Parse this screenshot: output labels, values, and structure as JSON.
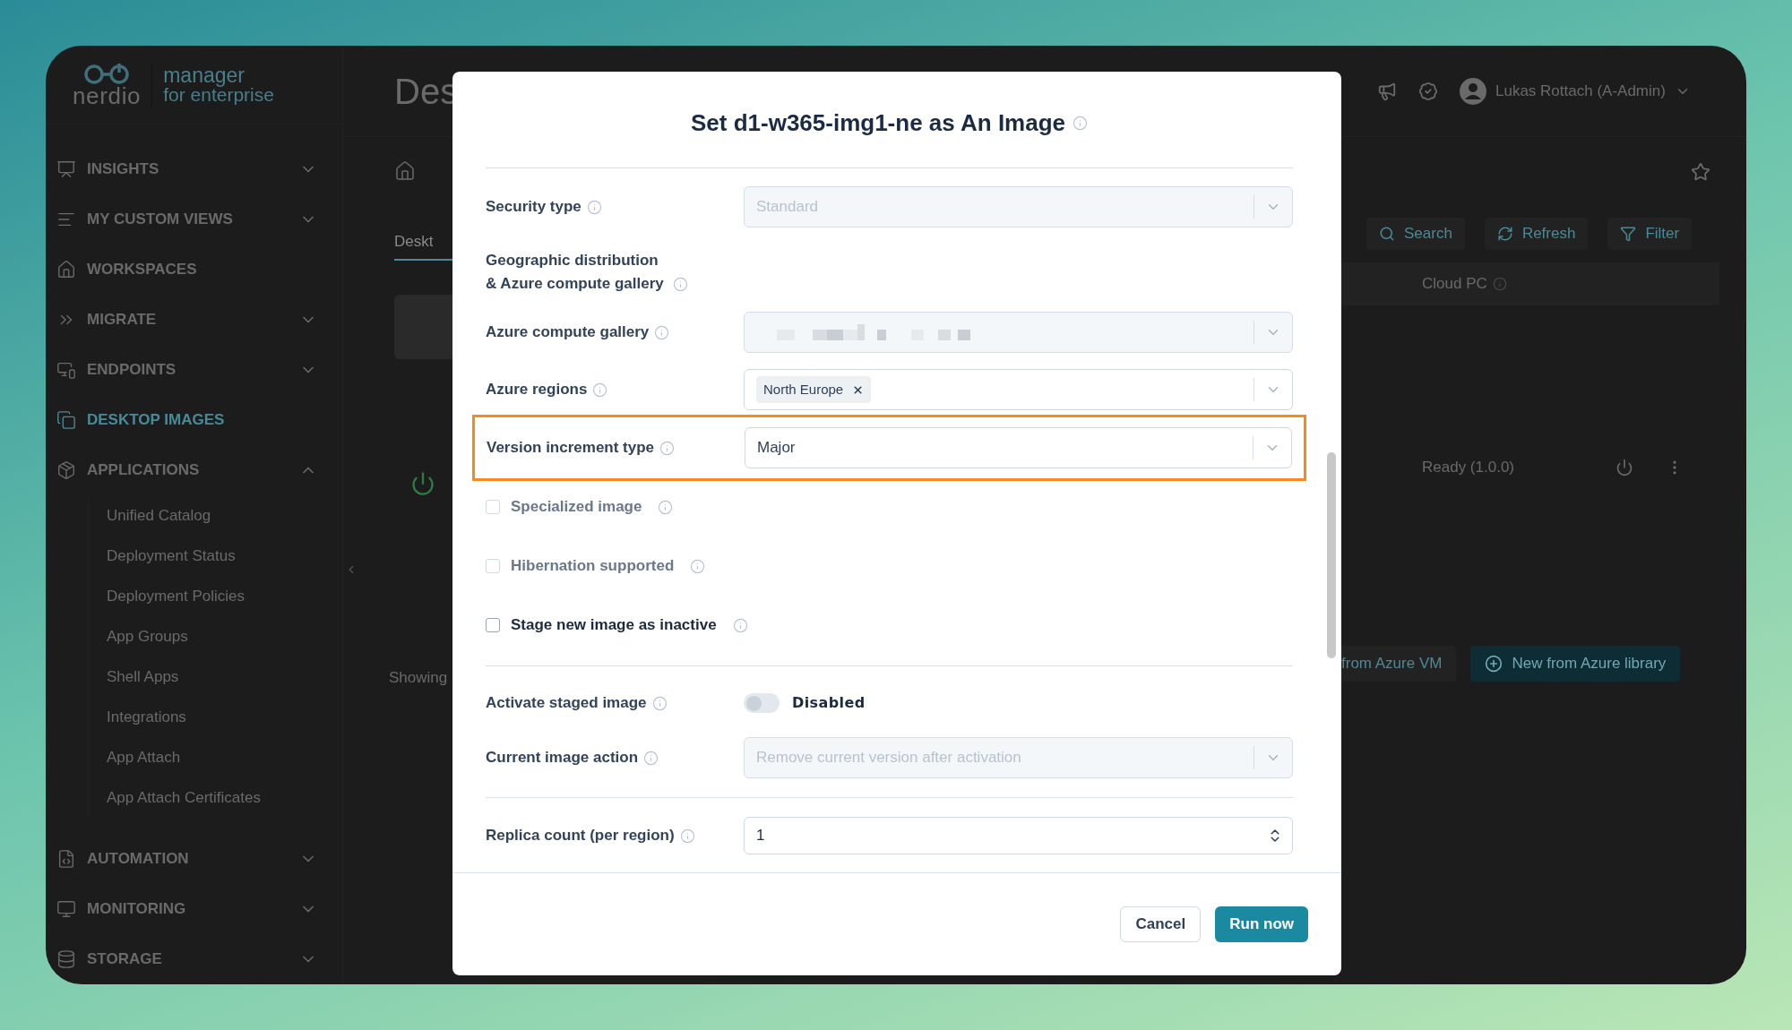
{
  "sidebar": {
    "logo": {
      "wordmark": "nerdio",
      "line1": "manager",
      "line2": "for enterprise"
    },
    "items": [
      {
        "label": "INSIGHTS",
        "kind": "group",
        "expanded": false,
        "selected": false
      },
      {
        "label": "MY CUSTOM VIEWS",
        "kind": "group",
        "expanded": false,
        "selected": false
      },
      {
        "label": "WORKSPACES",
        "kind": "link",
        "selected": false
      },
      {
        "label": "MIGRATE",
        "kind": "group",
        "expanded": false,
        "selected": false
      },
      {
        "label": "ENDPOINTS",
        "kind": "group",
        "expanded": false,
        "selected": false
      },
      {
        "label": "DESKTOP IMAGES",
        "kind": "link",
        "selected": true
      },
      {
        "label": "APPLICATIONS",
        "kind": "group",
        "expanded": true,
        "selected": false,
        "children": [
          {
            "label": "Unified Catalog"
          },
          {
            "label": "Deployment Status"
          },
          {
            "label": "Deployment Policies"
          },
          {
            "label": "App Groups"
          },
          {
            "label": "Shell Apps"
          },
          {
            "label": "Integrations"
          },
          {
            "label": "App Attach"
          },
          {
            "label": "App Attach Certificates"
          }
        ]
      },
      {
        "label": "AUTOMATION",
        "kind": "group",
        "expanded": false,
        "selected": false
      },
      {
        "label": "MONITORING",
        "kind": "group",
        "expanded": false,
        "selected": false
      },
      {
        "label": "STORAGE",
        "kind": "group",
        "expanded": false,
        "selected": false
      }
    ]
  },
  "page": {
    "title": "Des",
    "user": "Lukas Rottach (A-Admin)",
    "tab": {
      "label": "Deskt",
      "selected": true
    },
    "toolbar": [
      "Search",
      "Refresh",
      "Filter"
    ],
    "table": {
      "column": "Cloud PC",
      "row_status": "Ready (1.0.0)"
    },
    "showing": "Showing",
    "bottom_buttons": [
      {
        "label": "from Azure VM",
        "kind": "secondary"
      },
      {
        "label": "New from Azure library",
        "kind": "primary"
      }
    ]
  },
  "modal": {
    "title": "Set d1-w365-img1-ne as An Image",
    "fields": [
      {
        "kind": "select",
        "label": "Security type",
        "value": "Standard",
        "disabled": true,
        "highlighted": false
      },
      {
        "kind": "heading",
        "label": "Geographic distribution & Azure compute gallery"
      },
      {
        "kind": "redacted",
        "label": "Azure compute gallery"
      },
      {
        "kind": "tags",
        "label": "Azure regions",
        "tags": [
          "North Europe"
        ]
      },
      {
        "kind": "select",
        "label": "Version increment type",
        "value": "Major",
        "disabled": false,
        "highlighted": true
      },
      {
        "kind": "checkbox",
        "label": "Specialized image",
        "checked": false,
        "disabled": true
      },
      {
        "kind": "checkbox",
        "label": "Hibernation supported",
        "checked": false,
        "disabled": true
      },
      {
        "kind": "checkbox",
        "label": "Stage new image as inactive",
        "checked": false,
        "disabled": false
      },
      {
        "kind": "divider"
      },
      {
        "kind": "toggle",
        "label": "Activate staged image",
        "on": false,
        "state_label": "Disabled"
      },
      {
        "kind": "select",
        "label": "Current image action",
        "value": "Remove current version after activation",
        "disabled": true,
        "highlighted": false
      },
      {
        "kind": "divider"
      },
      {
        "kind": "number",
        "label": "Replica count (per region)",
        "value": "1"
      }
    ],
    "buttons": [
      {
        "label": "Cancel",
        "kind": "secondary"
      },
      {
        "label": "Run now",
        "kind": "primary"
      }
    ]
  }
}
